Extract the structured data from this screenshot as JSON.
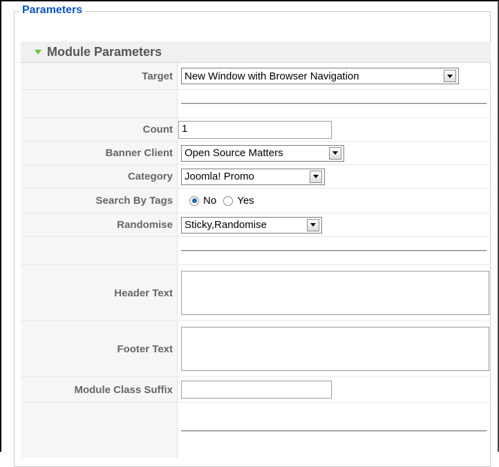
{
  "fieldset": {
    "legend": "Parameters"
  },
  "panel": {
    "title": "Module Parameters"
  },
  "fields": {
    "target": {
      "label": "Target",
      "value": "New Window with Browser Navigation"
    },
    "count": {
      "label": "Count",
      "value": "1"
    },
    "banner_client": {
      "label": "Banner Client",
      "value": "Open Source Matters"
    },
    "category": {
      "label": "Category",
      "value": "Joomla! Promo"
    },
    "search_by_tags": {
      "label": "Search By Tags",
      "options": [
        "No",
        "Yes"
      ],
      "selected": "No"
    },
    "randomise": {
      "label": "Randomise",
      "value": "Sticky,Randomise"
    },
    "header_text": {
      "label": "Header Text",
      "value": ""
    },
    "footer_text": {
      "label": "Footer Text",
      "value": ""
    },
    "module_class_suffix": {
      "label": "Module Class Suffix",
      "value": ""
    }
  },
  "colors": {
    "legend": "#0b55c4",
    "triangle": "#6fbe43",
    "label": "#666666"
  }
}
